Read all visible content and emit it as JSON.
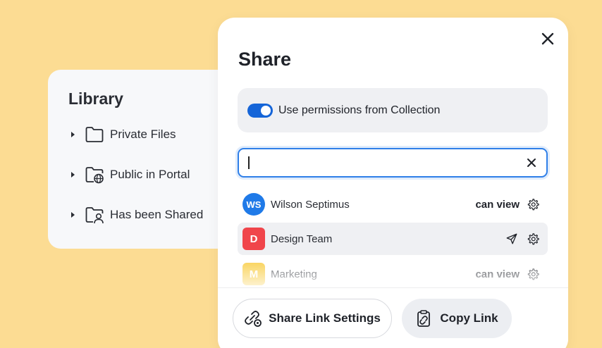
{
  "library": {
    "title": "Library",
    "items": [
      {
        "label": "Private Files",
        "icon": "folder-icon"
      },
      {
        "label": "Public in Portal",
        "icon": "folder-globe-icon"
      },
      {
        "label": "Has been Shared",
        "icon": "folder-user-icon"
      }
    ]
  },
  "dialog": {
    "title": "Share",
    "permissions_toggle": {
      "label": "Use permissions from Collection",
      "on": true
    },
    "search": {
      "value": "",
      "placeholder": ""
    },
    "users": [
      {
        "initials": "WS",
        "name": "Wilson Septimus",
        "permission": "can view",
        "color": "#1f7ae8"
      },
      {
        "initials": "D",
        "name": "Design Team",
        "permission": "",
        "color": "#f0454b"
      },
      {
        "initials": "M",
        "name": "Marketing",
        "permission": "can view",
        "color": "#f7c21b"
      }
    ],
    "footer": {
      "share_link_settings": "Share Link Settings",
      "copy_link": "Copy Link"
    }
  },
  "colors": {
    "background": "#fcdc93",
    "accent": "#1565d8"
  }
}
